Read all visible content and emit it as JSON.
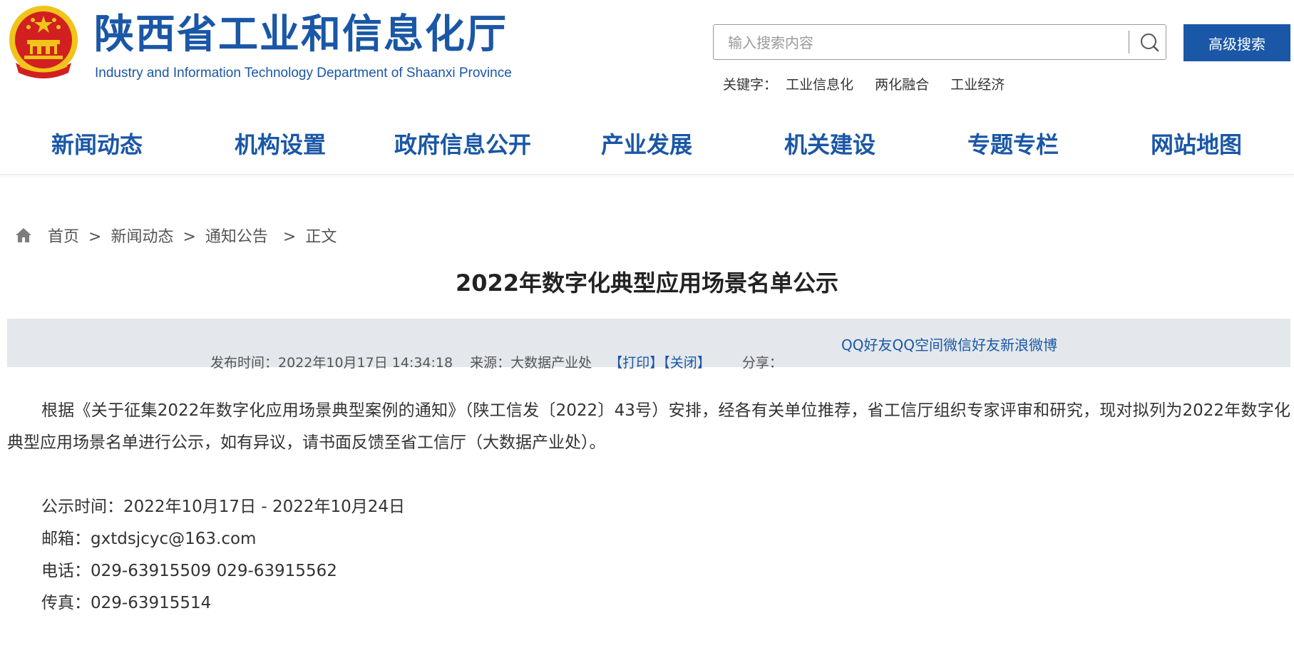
{
  "header": {
    "title": "陕西省工业和信息化厅",
    "subtitle": "Industry and Information Technology Department of Shaanxi Province",
    "search_placeholder": "输入搜索内容",
    "advanced_search_label": "高级搜索",
    "keywords_label": "关键字：",
    "keywords": [
      "工业信息化",
      "两化融合",
      "工业经济"
    ]
  },
  "nav": {
    "items": [
      "新闻动态",
      "机构设置",
      "政府信息公开",
      "产业发展",
      "机关建设",
      "专题专栏",
      "网站地图"
    ]
  },
  "breadcrumb": {
    "items": [
      "首页",
      "新闻动态",
      "通知公告",
      "正文"
    ],
    "separator": ">"
  },
  "article": {
    "title": "2022年数字化典型应用场景名单公示",
    "meta": {
      "publish_label": "发布时间：",
      "publish_time": "2022年10月17日 14:34:18",
      "source_label": "来源：",
      "source": "大数据产业处",
      "print_label": "【打印】",
      "close_label": "【关闭】",
      "share_label": "分享："
    },
    "share_links": [
      "QQ好友",
      "QQ空间",
      "微信好友",
      "新浪微博"
    ],
    "paragraph": "根据《关于征集2022年数字化应用场景典型案例的通知》（陕工信发〔2022〕43号）安排，经各有关单位推荐，省工信厅组织专家评审和研究，现对拟列为2022年数字化典型应用场景名单进行公示，如有异议，请书面反馈至省工信厅（大数据产业处）。",
    "info_lines": [
      "公示时间：2022年10月17日 - 2022年10月24日",
      "邮箱：gxtdsjcyc@163.com",
      "电话：029-63915509 029-63915562",
      "传真：029-63915514"
    ]
  },
  "colors": {
    "brand_blue": "#1a57a6",
    "emblem_red": "#d21f1f",
    "emblem_gold": "#f0c419",
    "meta_bar_bg": "#e4e8ec"
  },
  "icons": {
    "emblem": "national-emblem-icon",
    "search": "search-icon",
    "home": "home-icon"
  }
}
